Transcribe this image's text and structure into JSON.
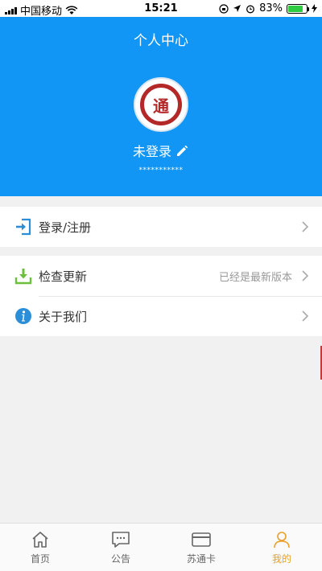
{
  "status_bar": {
    "carrier": "中国移动",
    "time": "15:21",
    "battery": "83%",
    "battery_level": 0.83
  },
  "header": {
    "title": "个人中心",
    "user_name": "未登录",
    "user_sub": "***********",
    "avatar_logo_char": "通"
  },
  "menu": {
    "login": {
      "label": "登录/注册",
      "icon": "login-icon"
    },
    "update": {
      "label": "检查更新",
      "meta": "已经是最新版本",
      "icon": "download-icon"
    },
    "about": {
      "label": "关于我们",
      "icon": "info-icon"
    }
  },
  "tabbar": {
    "tabs": [
      {
        "label": "首页",
        "icon": "home-icon"
      },
      {
        "label": "公告",
        "icon": "message-icon"
      },
      {
        "label": "苏通卡",
        "icon": "card-icon"
      },
      {
        "label": "我的",
        "icon": "user-icon"
      }
    ],
    "active_index": 3
  },
  "colors": {
    "header_bg": "#1296f5",
    "active_tab": "#e8a126",
    "login_icon": "#2a8fd8",
    "download_icon": "#6cbf3d",
    "info_icon": "#2a8fd8"
  }
}
